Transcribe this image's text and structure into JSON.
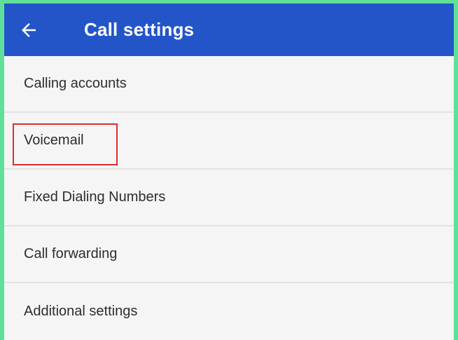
{
  "header": {
    "title": "Call settings",
    "back_icon": "arrow-left-icon",
    "background_color": "#2355c9"
  },
  "settings": {
    "items": [
      {
        "label": "Calling accounts"
      },
      {
        "label": "Voicemail",
        "highlighted": true
      },
      {
        "label": "Fixed Dialing Numbers"
      },
      {
        "label": "Call forwarding"
      },
      {
        "label": "Additional settings"
      }
    ]
  },
  "highlight_color": "#e02b2b"
}
